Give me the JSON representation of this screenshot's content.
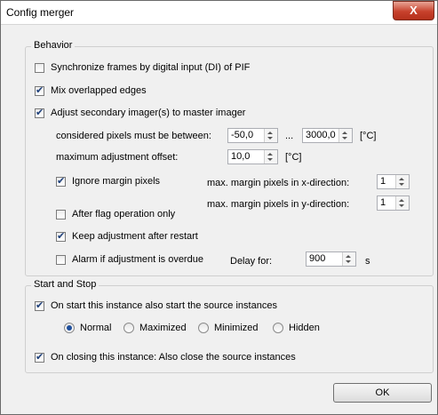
{
  "window": {
    "title": "Config merger",
    "close_glyph": "X"
  },
  "behavior": {
    "legend": "Behavior",
    "sync_frames": {
      "label": "Synchronize frames by digital input (DI) of PIF",
      "checked": false
    },
    "mix_edges": {
      "label": "Mix overlapped edges",
      "checked": true
    },
    "adjust_secondary": {
      "label": "Adjust secondary imager(s) to master imager",
      "checked": true
    },
    "pixels_between": {
      "label": "considered pixels must be between:",
      "min": "-50,0",
      "separator": "...",
      "max": "3000,0",
      "unit": "[°C]"
    },
    "max_offset": {
      "label": "maximum adjustment offset:",
      "value": "10,0",
      "unit": "[°C]"
    },
    "ignore_margin": {
      "label": "Ignore margin pixels",
      "checked": true
    },
    "margin_x": {
      "label": "max. margin pixels in x-direction:",
      "value": "1"
    },
    "margin_y": {
      "label": "max. margin pixels in y-direction:",
      "value": "1"
    },
    "after_flag": {
      "label": "After flag operation only",
      "checked": false
    },
    "keep_adjustment": {
      "label": "Keep adjustment after restart",
      "checked": true
    },
    "alarm_overdue": {
      "label": "Alarm if adjustment is overdue",
      "checked": false
    },
    "delay": {
      "label": "Delay for:",
      "value": "900",
      "unit": "s"
    }
  },
  "start_stop": {
    "legend": "Start and Stop",
    "start_sources": {
      "label": "On start this instance also start the source instances",
      "checked": true
    },
    "window_modes": [
      {
        "label": "Normal",
        "selected": true
      },
      {
        "label": "Maximized",
        "selected": false
      },
      {
        "label": "Minimized",
        "selected": false
      },
      {
        "label": "Hidden",
        "selected": false
      }
    ],
    "close_sources": {
      "label": "On closing this instance: Also close the source instances",
      "checked": true
    }
  },
  "footer": {
    "ok_label": "OK"
  }
}
